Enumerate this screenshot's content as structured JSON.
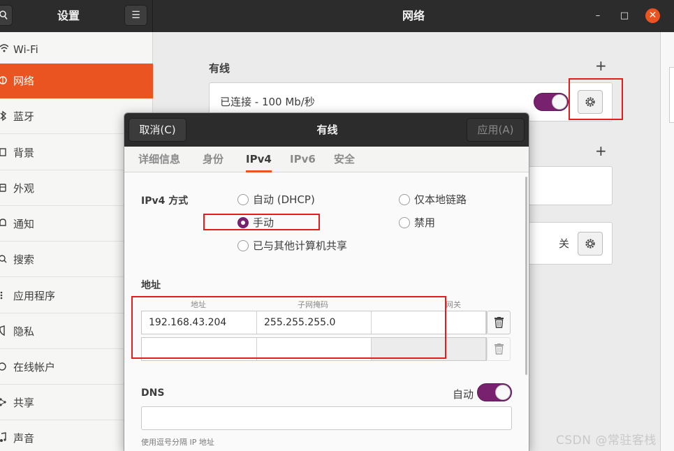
{
  "settings": {
    "title": "设置"
  },
  "window": {
    "title": "网络",
    "minimize": "–",
    "maximize": "□",
    "close": "✕"
  },
  "sidebar": {
    "items": [
      {
        "label": "Wi-Fi",
        "icon": "wifi-icon"
      },
      {
        "label": "网络",
        "icon": "network-icon",
        "active": true
      },
      {
        "label": "蓝牙",
        "icon": "bluetooth-icon"
      },
      {
        "label": "背景",
        "icon": "background-icon"
      },
      {
        "label": "外观",
        "icon": "appearance-icon"
      },
      {
        "label": "通知",
        "icon": "notification-icon"
      },
      {
        "label": "搜索",
        "icon": "search-icon"
      },
      {
        "label": "应用程序",
        "icon": "applications-icon"
      },
      {
        "label": "隐私",
        "icon": "privacy-icon"
      },
      {
        "label": "在线帐户",
        "icon": "online-accounts-icon"
      },
      {
        "label": "共享",
        "icon": "share-icon"
      },
      {
        "label": "声音",
        "icon": "sound-icon"
      }
    ]
  },
  "main": {
    "wired": {
      "title": "有线",
      "add": "+",
      "connection": "已连接 - 100 Mb/秒",
      "enabled": true
    },
    "vpn": {
      "add": "+"
    },
    "proxy": {
      "status": "关"
    }
  },
  "dialog": {
    "title": "有线",
    "cancel": "取消(C)",
    "apply": "应用(A)",
    "tabs": [
      "详细信息",
      "身份",
      "IPv4",
      "IPv6",
      "安全"
    ],
    "active_tab": "IPv4",
    "ipv4": {
      "method_label": "IPv4 方式",
      "methods": {
        "dhcp": "自动 (DHCP)",
        "link_local": "仅本地链路",
        "manual": "手动",
        "disabled": "禁用",
        "shared": "已与其他计算机共享"
      },
      "selected": "manual",
      "address_label": "地址",
      "columns": [
        "地址",
        "子网掩码",
        "网关"
      ],
      "rows": [
        {
          "address": "192.168.43.204",
          "netmask": "255.255.255.0",
          "gateway": ""
        },
        {
          "address": "",
          "netmask": "",
          "gateway": ""
        }
      ],
      "dns_label": "DNS",
      "dns_auto_label": "自动",
      "dns_auto": true,
      "dns_value": "",
      "dns_hint": "使用逗号分隔 IP 地址"
    }
  },
  "watermark": "CSDN @常驻客栈",
  "colors": {
    "accent": "#e95420",
    "switch_on": "#77216f",
    "annotation": "#e21d1d"
  }
}
